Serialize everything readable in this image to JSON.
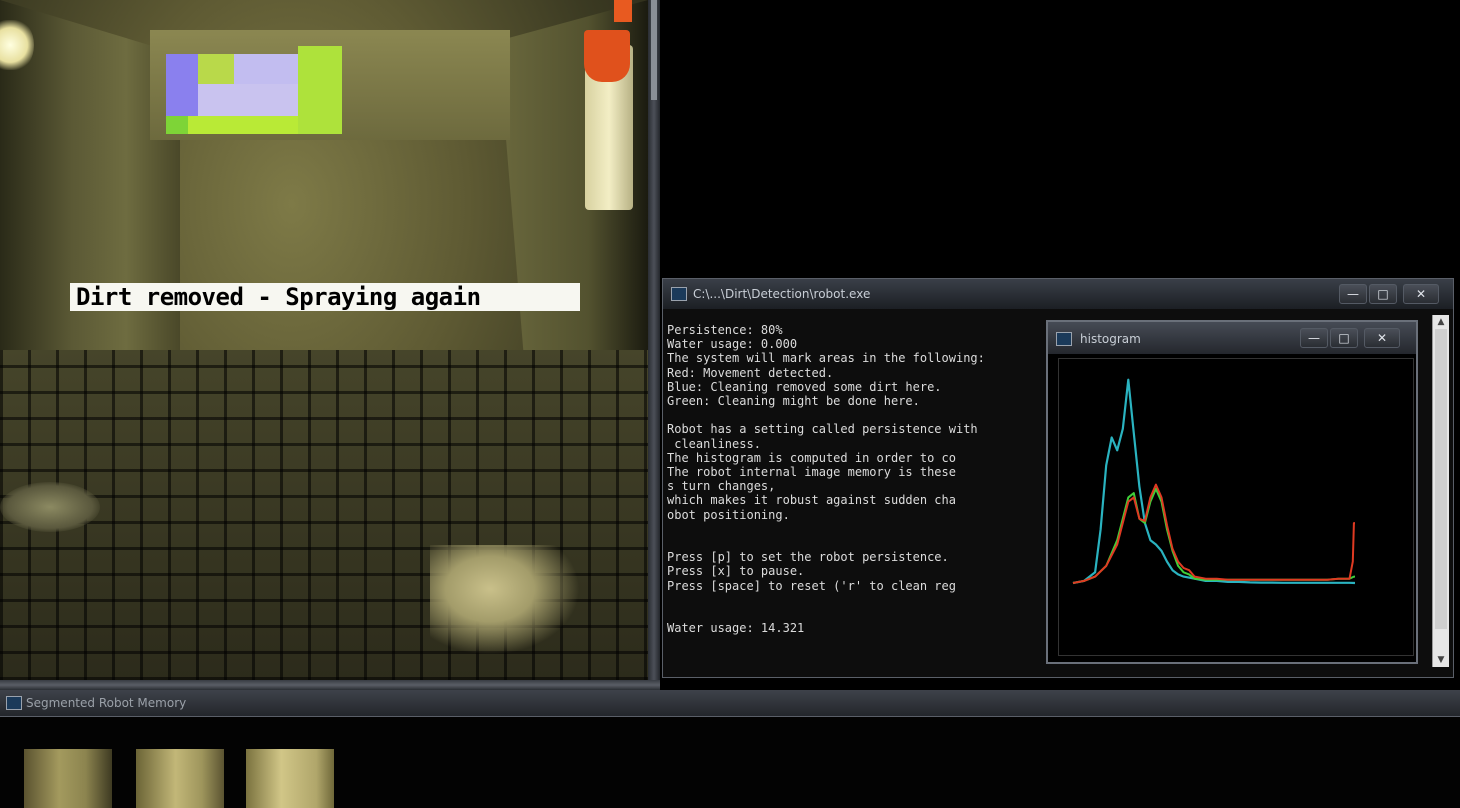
{
  "camera": {
    "status_text": "Dirt removed - Spraying again"
  },
  "console": {
    "title": "C:\\...\\Dirt\\Detection\\robot.exe",
    "lines": [
      "Persistence: 80%",
      "Water usage: 0.000",
      "The system will mark areas in the following:",
      "Red: Movement detected.",
      "Blue: Cleaning removed some dirt here.",
      "Green: Cleaning might be done here.",
      "",
      "Robot has a setting called persistence with",
      " cleanliness.",
      "The histogram is computed in order to co",
      "The robot internal image memory is these",
      "s turn changes,",
      "which makes it robust against sudden cha",
      "obot positioning.",
      "",
      "",
      "Press [p] to set the robot persistence.",
      "Press [x] to pause.",
      "Press [space] to reset ('r' to clean reg",
      "",
      "",
      "Water usage: 14.321"
    ],
    "controls": {
      "minimize": "—",
      "maximize": "□",
      "close": "✕"
    }
  },
  "histogram": {
    "title": "histogram",
    "controls": {
      "minimize": "—",
      "maximize": "□",
      "close": "✕"
    }
  },
  "bottom_window": {
    "title": "Segmented Robot Memory"
  },
  "colors": {
    "cyan_series": "#2ab3c0",
    "green_series": "#3fcf3a",
    "red_series": "#e03a22",
    "orange_series": "#e0902a"
  },
  "chart_data": {
    "type": "line",
    "xlim": [
      0,
      255
    ],
    "ylim": [
      0,
      1
    ],
    "series": [
      {
        "x": [
          0,
          10,
          20,
          25,
          30,
          35,
          40,
          45,
          50,
          55,
          60,
          65,
          70,
          75,
          80,
          85,
          90,
          95,
          100,
          110,
          120,
          130,
          140,
          150,
          160,
          170,
          180,
          190,
          200,
          210,
          220,
          230,
          240,
          250,
          255
        ],
        "values": [
          0,
          0.01,
          0.05,
          0.25,
          0.55,
          0.68,
          0.62,
          0.72,
          0.95,
          0.7,
          0.45,
          0.28,
          0.2,
          0.18,
          0.15,
          0.1,
          0.06,
          0.04,
          0.03,
          0.02,
          0.01,
          0.01,
          0.005,
          0.005,
          0.003,
          0.002,
          0.002,
          0.001,
          0.001,
          0.001,
          0.001,
          0.001,
          0.001,
          0.001,
          0.0
        ]
      },
      {
        "x": [
          0,
          10,
          20,
          30,
          40,
          50,
          55,
          60,
          65,
          70,
          75,
          80,
          85,
          90,
          95,
          100,
          105,
          110,
          120,
          130,
          140,
          150,
          160,
          170,
          180,
          190,
          200,
          210,
          220,
          230,
          240,
          250,
          254,
          255
        ],
        "values": [
          0,
          0.01,
          0.03,
          0.08,
          0.2,
          0.4,
          0.42,
          0.3,
          0.28,
          0.38,
          0.44,
          0.38,
          0.25,
          0.15,
          0.08,
          0.05,
          0.04,
          0.02,
          0.015,
          0.015,
          0.015,
          0.015,
          0.015,
          0.015,
          0.015,
          0.015,
          0.015,
          0.015,
          0.015,
          0.015,
          0.02,
          0.02,
          0.03,
          0.03
        ]
      },
      {
        "x": [
          0,
          10,
          20,
          30,
          40,
          50,
          55,
          60,
          65,
          70,
          75,
          80,
          85,
          90,
          95,
          100,
          105,
          110,
          120,
          130,
          140,
          150,
          160,
          170,
          180,
          190,
          200,
          210,
          220,
          230,
          240,
          250,
          253,
          254,
          255
        ],
        "values": [
          0,
          0.01,
          0.03,
          0.08,
          0.18,
          0.38,
          0.4,
          0.3,
          0.29,
          0.4,
          0.46,
          0.4,
          0.27,
          0.16,
          0.1,
          0.07,
          0.06,
          0.03,
          0.02,
          0.02,
          0.015,
          0.015,
          0.015,
          0.015,
          0.015,
          0.015,
          0.015,
          0.015,
          0.015,
          0.015,
          0.02,
          0.02,
          0.1,
          0.28,
          0.28
        ]
      }
    ]
  }
}
